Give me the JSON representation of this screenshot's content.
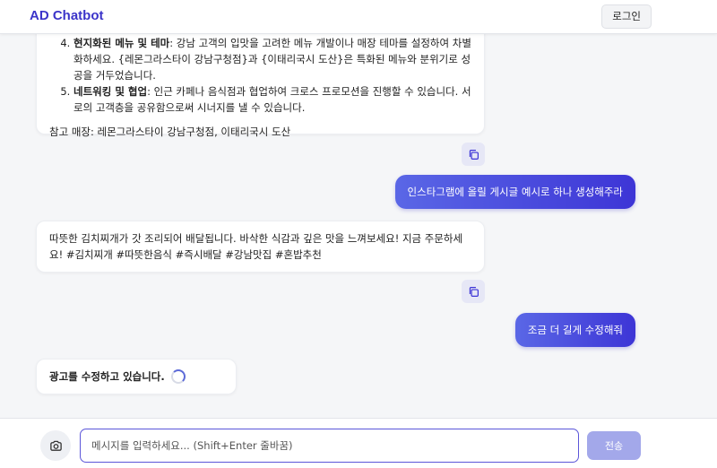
{
  "header": {
    "title": "AD Chatbot",
    "login_label": "로그인"
  },
  "messages": {
    "bot1": {
      "items": [
        {
          "num": 4,
          "bold": "현지화된 메뉴 및 테마",
          "text": ": 강남 고객의 입맛을 고려한 메뉴 개발이나 매장 테마를 설정하여 차별화하세요. {레몬그라스타이 강남구청점}과 {이태리국시 도산}은 특화된 메뉴와 분위기로 성공을 거두었습니다."
        },
        {
          "num": 5,
          "bold": "네트워킹 및 협업",
          "text": ": 인근 카페나 음식점과 협업하여 크로스 프로모션을 진행할 수 있습니다. 서로의 고객층을 공유함으로써 시너지를 낼 수 있습니다."
        }
      ],
      "reference": "참고 매장: 레몬그라스타이 강남구청점, 이태리국시 도산"
    },
    "user1": "인스타그램에 올릴 게시글 예시로 하나 생성해주라",
    "bot2": "따뜻한 김치찌개가 갓 조리되어 배달됩니다. 바삭한 식감과 깊은 맛을 느껴보세요! 지금 주문하세요! #김치찌개 #따뜻한음식 #즉시배달 #강남맛집 #혼밥추천",
    "user2": "조금 더 길게 수정해줘",
    "bot3_loading": "광고를 수정하고 있습니다."
  },
  "input": {
    "placeholder": "메시지를 입력하세요... (Shift+Enter 줄바꿈)",
    "value": "",
    "send_label": "전송"
  },
  "icons": {
    "copy": "copy-icon",
    "camera": "camera-icon",
    "spinner": "loading-spinner-icon"
  },
  "colors": {
    "brand": "#3b34c9",
    "user_bubble_start": "#5a67e6",
    "user_bubble_end": "#3d35d6",
    "send_disabled": "#a3a8ea",
    "input_border": "#5b56d9"
  }
}
